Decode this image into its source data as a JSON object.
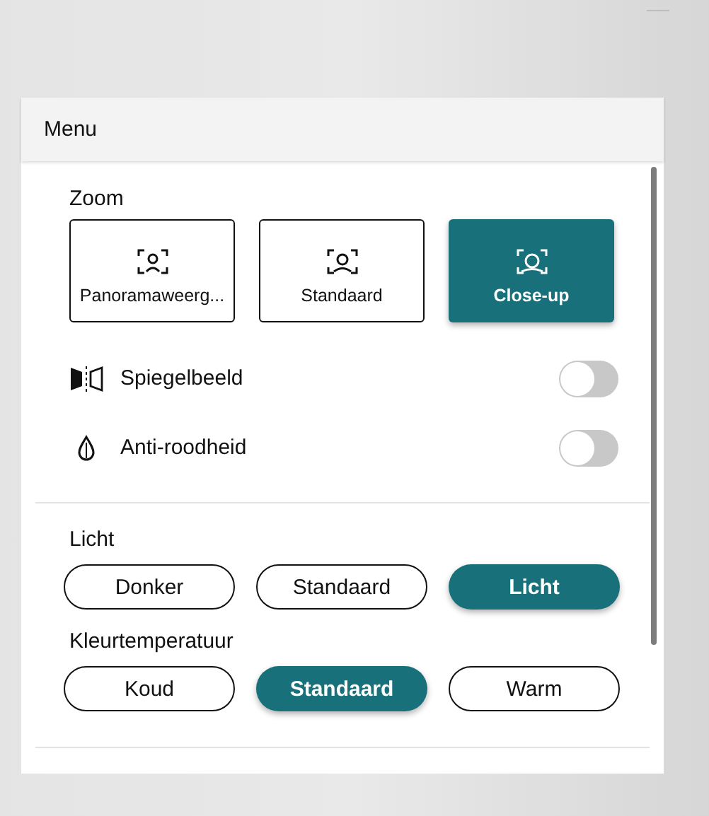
{
  "panel": {
    "title": "Menu"
  },
  "zoom": {
    "label": "Zoom",
    "options": [
      {
        "label": "Panoramaweerg...",
        "selected": false,
        "kind": "wide"
      },
      {
        "label": "Standaard",
        "selected": false,
        "kind": "normal"
      },
      {
        "label": "Close-up",
        "selected": true,
        "kind": "close"
      }
    ]
  },
  "toggles": [
    {
      "label": "Spiegelbeeld",
      "on": false,
      "kind": "mirror"
    },
    {
      "label": "Anti-roodheid",
      "on": false,
      "kind": "drop"
    }
  ],
  "light": {
    "label": "Licht",
    "options": [
      {
        "label": "Donker",
        "selected": false
      },
      {
        "label": "Standaard",
        "selected": false
      },
      {
        "label": "Licht",
        "selected": true
      }
    ]
  },
  "temperature": {
    "label": "Kleurtemperatuur",
    "options": [
      {
        "label": "Koud",
        "selected": false
      },
      {
        "label": "Standaard",
        "selected": true
      },
      {
        "label": "Warm",
        "selected": false
      }
    ]
  }
}
